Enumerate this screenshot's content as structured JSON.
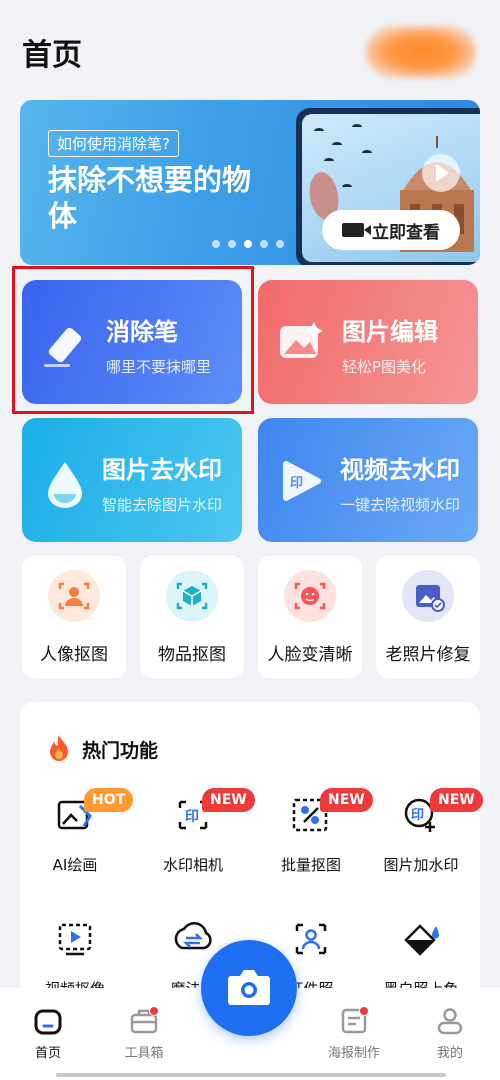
{
  "header": {
    "title": "首页"
  },
  "banner": {
    "question": "如何使用消除笔?",
    "title": "抹除不想要的物体",
    "watch_label": "立即查看",
    "dots": 5,
    "active_dot": 3
  },
  "big_cards": [
    {
      "title": "消除笔",
      "subtitle": "哪里不要抹哪里",
      "icon": "eraser-pen-icon",
      "color": "#3f72f5"
    },
    {
      "title": "图片编辑",
      "subtitle": "轻松P图美化",
      "icon": "image-edit-icon",
      "color": "#f06b6b"
    },
    {
      "title": "图片去水印",
      "subtitle": "智能去除图片水印",
      "icon": "image-watermark-remove-icon",
      "color": "#21b2e8"
    },
    {
      "title": "视频去水印",
      "subtitle": "一键去除视频水印",
      "icon": "video-watermark-remove-icon",
      "color": "#3d8df1"
    }
  ],
  "small_cards": [
    {
      "label": "人像抠图",
      "icon": "portrait-cutout-icon",
      "color": "#ff8a4a"
    },
    {
      "label": "物品抠图",
      "icon": "object-cutout-icon",
      "color": "#2fb6c8"
    },
    {
      "label": "人脸变清晰",
      "icon": "face-enhance-icon",
      "color": "#ff5d5d"
    },
    {
      "label": "老照片修复",
      "icon": "photo-restore-icon",
      "color": "#4a5ecb"
    }
  ],
  "hot": {
    "title": "热门功能",
    "items": [
      {
        "label": "AI绘画",
        "icon": "ai-draw-icon",
        "badge": "HOT"
      },
      {
        "label": "水印相机",
        "icon": "watermark-camera-icon",
        "badge": "NEW"
      },
      {
        "label": "批量抠图",
        "icon": "batch-cutout-icon",
        "badge": "NEW"
      },
      {
        "label": "图片加水印",
        "icon": "add-watermark-icon",
        "badge": "NEW"
      },
      {
        "label": "视频抠像",
        "icon": "video-cutout-icon",
        "badge": ""
      },
      {
        "label": "魔法换",
        "icon": "magic-swap-icon",
        "badge": ""
      },
      {
        "label": "证件照",
        "icon": "id-photo-icon",
        "badge": ""
      },
      {
        "label": "黑白照上色",
        "icon": "colorize-icon",
        "badge": ""
      }
    ]
  },
  "tabs": [
    {
      "label": "首页",
      "icon": "home-icon",
      "active": true,
      "dot": false
    },
    {
      "label": "工具箱",
      "icon": "toolbox-icon",
      "active": false,
      "dot": true
    },
    {
      "label": "海报制作",
      "icon": "poster-icon",
      "active": false,
      "dot": true
    },
    {
      "label": "我的",
      "icon": "profile-icon",
      "active": false,
      "dot": false
    }
  ],
  "colors": {
    "accent": "#1f6ff2",
    "badge_hot": "#ff9a2e",
    "badge_new": "#ef3a3a",
    "highlight_frame": "#e0141a"
  }
}
